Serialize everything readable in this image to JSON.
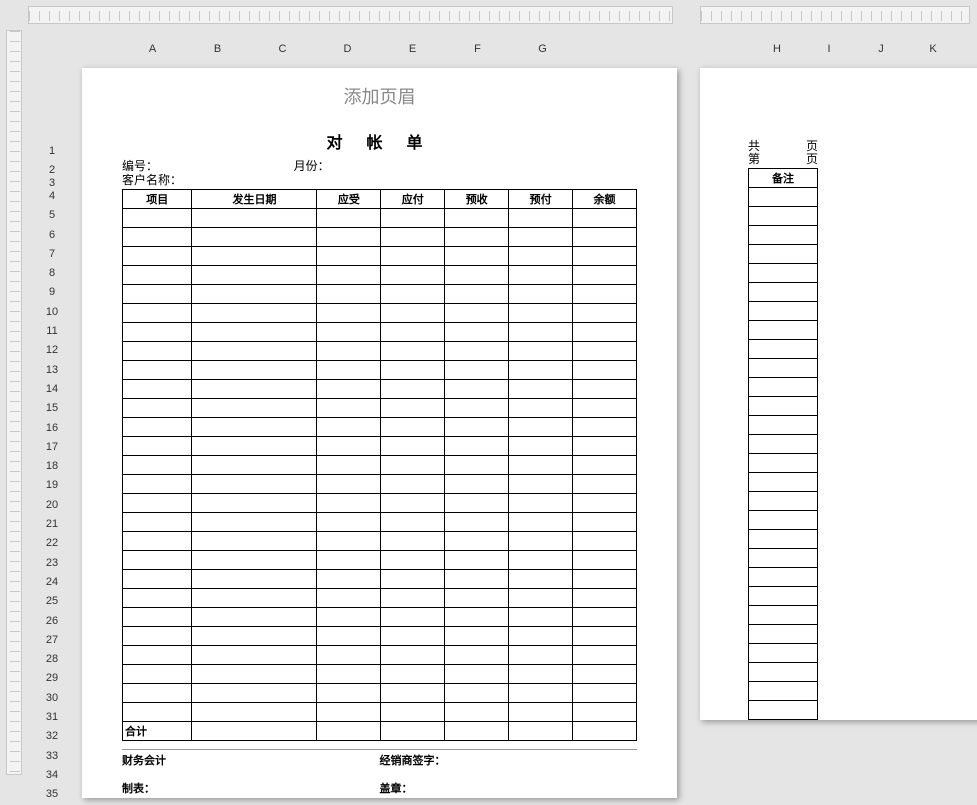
{
  "columns": [
    "A",
    "B",
    "C",
    "D",
    "E",
    "F",
    "G",
    "H",
    "I",
    "J",
    "K"
  ],
  "row_numbers": [
    1,
    2,
    3,
    4,
    5,
    6,
    7,
    8,
    9,
    10,
    11,
    12,
    13,
    14,
    15,
    16,
    17,
    18,
    19,
    20,
    21,
    22,
    23,
    24,
    25,
    26,
    27,
    28,
    29,
    30,
    31,
    32,
    33,
    34,
    35
  ],
  "header_placeholder": "添加页眉",
  "title": "对  帐  单",
  "labels": {
    "serial": "编号：",
    "month": "月份：",
    "customer": "客户名称："
  },
  "table_headers": [
    "项目",
    "发生日期",
    "应受",
    "应付",
    "预收",
    "预付",
    "余额"
  ],
  "total_label": "合计",
  "footer": {
    "finance": "财务会计",
    "maker": "制表：",
    "dealer_sign": "经销商签字：",
    "stamp": "盖章："
  },
  "page2": {
    "total_label_a": "共",
    "total_label_b": "页",
    "current_label_a": "第",
    "current_label_b": "页",
    "remark_header": "备注"
  }
}
